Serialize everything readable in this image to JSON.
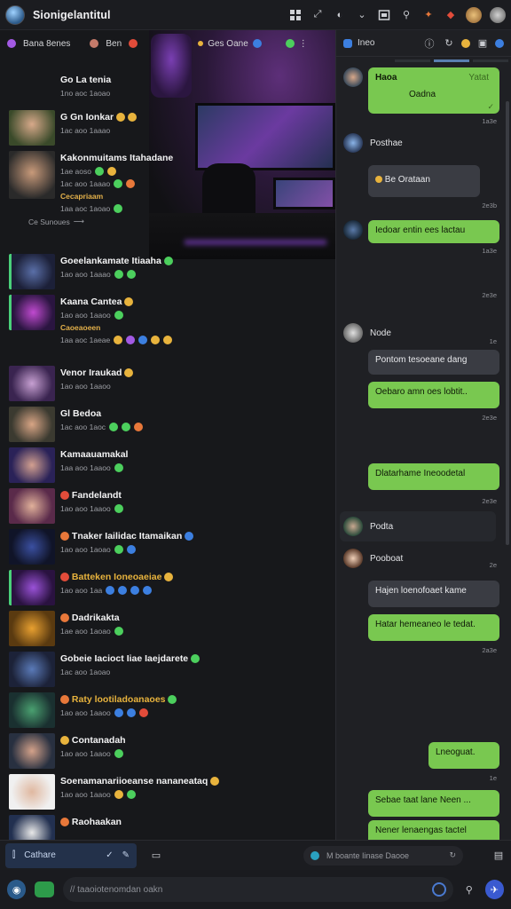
{
  "app": {
    "title": "Sionigelantitul"
  },
  "left": {
    "header_label": "Bana 8enes",
    "header_badge_1": "Ben",
    "header_right": "Ges Oane",
    "streams": [
      {
        "name": "Go La tenia",
        "meta": "1no aoc 1aoao"
      },
      {
        "name": "G Gn Ionkar",
        "meta": "1ac aoo 1aaao"
      },
      {
        "name": "Kakonmuitams Itahadane",
        "meta": "1ae aoso",
        "tag": "Cecapriaam",
        "meta2": "1aa aoc 1aoao"
      },
      {
        "name": "Goeelankamate Itiaaha",
        "meta": "1ao aoo 1aaao"
      },
      {
        "name": "Kaana Cantea",
        "meta": "1ao aoo 1aaoo",
        "tag": "Caoeaoeen",
        "meta2": "1aa aoc 1aeae"
      },
      {
        "name": "Venor Iraukad",
        "meta": "1ao aoo 1aaoo"
      },
      {
        "name": "Gl Bedoa",
        "meta": "1ac aoo 1aoc"
      },
      {
        "name": "Kamaauamakal",
        "meta": "1aa aoo 1aaoo"
      },
      {
        "name": "Fandelandt",
        "meta": "1ao aoo 1aaoo"
      },
      {
        "name": "Tnaker Iailidac Itamaikan",
        "meta": "1ao aoo 1aoao"
      },
      {
        "name": "Batteken Ioneoaeiae",
        "meta": "1ao aoo 1aa"
      },
      {
        "name": "Dadrikakta",
        "meta": "1ae aoo 1aoao"
      },
      {
        "name": "Gobeie Iacioct Iiae Iaejdarete",
        "meta": "1ac aoo 1aoao"
      },
      {
        "name": "Raty lootiladoanaoes",
        "meta": "1ao aoo 1aaoo"
      },
      {
        "name": "Contanadah",
        "meta": "1ao aoo 1aaoo"
      },
      {
        "name": "Soenamanariioeanse nananeataq",
        "meta": "1ao aoo 1aaoo"
      },
      {
        "name": "Raohaakan",
        "meta": ""
      }
    ],
    "channel_label": "Ce Sunoues"
  },
  "right": {
    "header_label": "Ineo",
    "messages": {
      "m1_title": "Haoa",
      "m1_sub": "Yatat",
      "m1_body": "Oadna",
      "s1_name": "Posthae",
      "m2_body": "Be Orataan",
      "m3_body": "Iedoar entin ees lactau",
      "s2_name": "Node",
      "m4_body": "Pontom tesoeane dang",
      "m5_body": "Oebaro amn oes lobtit..",
      "m6_body": "Dlatarhame Ineoodetal",
      "s3_name": "Podta",
      "s4_name": "Pooboat",
      "m7_body": "Hajen loenofoaet kame",
      "m8_body": "Hatar hemeaneo le tedat.",
      "m9_body": "Lneoguat.",
      "m10_body": "Sebae taat lane Neen ...",
      "m11_body": "Nener lenaengas tactel",
      "stamps": [
        "1a3e",
        "2e3b",
        "1a3e",
        "2e3e",
        "1e",
        "2e3e",
        "2e3e",
        "2e",
        "2a3e",
        "1e"
      ]
    }
  },
  "bottom": {
    "tab_label": "Cathare",
    "search_placeholder": "M boante Iinase Daooe",
    "compose_placeholder": "// taaoiotenomdan oakn"
  }
}
